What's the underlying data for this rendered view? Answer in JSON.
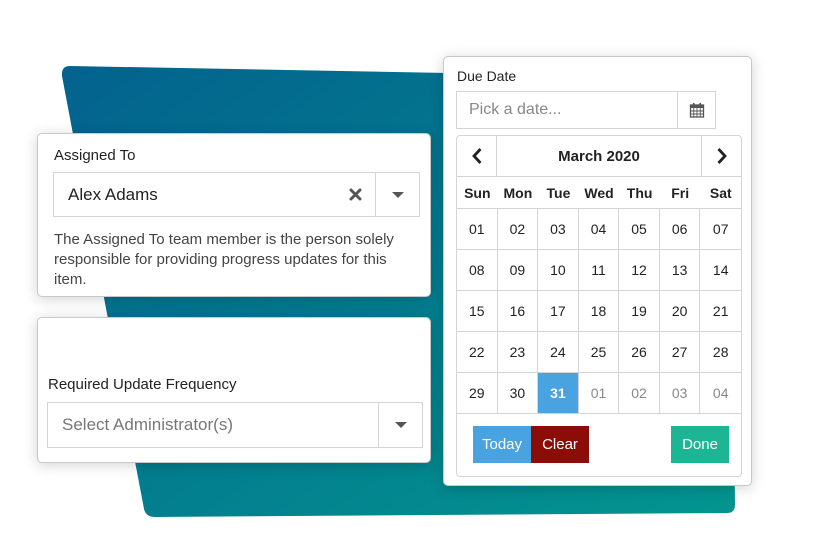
{
  "theme": {
    "accent_blue": "#49a3e0",
    "clear_red": "#8c0d07",
    "done_green": "#1cb694",
    "bg_gradient_start": "#03628e",
    "bg_gradient_end": "#03958f"
  },
  "assigned_to": {
    "label": "Assigned To",
    "value": "Alex Adams",
    "clear_icon": "close-icon",
    "dropdown_icon": "caret-down-icon",
    "help_text": "The Assigned To team member is the person solely responsible for providing progress updates for this item."
  },
  "update_frequency": {
    "label": "Required Update Frequency",
    "placeholder": "Select Administrator(s)",
    "dropdown_icon": "caret-down-icon"
  },
  "due_date": {
    "label": "Due Date",
    "placeholder": "Pick a date...",
    "value": "",
    "calendar_icon": "calendar-icon"
  },
  "calendar": {
    "month_title": "March 2020",
    "prev_icon": "chevron-left-icon",
    "next_icon": "chevron-right-icon",
    "weekdays": [
      "Sun",
      "Mon",
      "Tue",
      "Wed",
      "Thu",
      "Fri",
      "Sat"
    ],
    "days": [
      {
        "label": "01",
        "muted": false,
        "selected": false
      },
      {
        "label": "02",
        "muted": false,
        "selected": false
      },
      {
        "label": "03",
        "muted": false,
        "selected": false
      },
      {
        "label": "04",
        "muted": false,
        "selected": false
      },
      {
        "label": "05",
        "muted": false,
        "selected": false
      },
      {
        "label": "06",
        "muted": false,
        "selected": false
      },
      {
        "label": "07",
        "muted": false,
        "selected": false
      },
      {
        "label": "08",
        "muted": false,
        "selected": false
      },
      {
        "label": "09",
        "muted": false,
        "selected": false
      },
      {
        "label": "10",
        "muted": false,
        "selected": false
      },
      {
        "label": "11",
        "muted": false,
        "selected": false
      },
      {
        "label": "12",
        "muted": false,
        "selected": false
      },
      {
        "label": "13",
        "muted": false,
        "selected": false
      },
      {
        "label": "14",
        "muted": false,
        "selected": false
      },
      {
        "label": "15",
        "muted": false,
        "selected": false
      },
      {
        "label": "16",
        "muted": false,
        "selected": false
      },
      {
        "label": "17",
        "muted": false,
        "selected": false
      },
      {
        "label": "18",
        "muted": false,
        "selected": false
      },
      {
        "label": "19",
        "muted": false,
        "selected": false
      },
      {
        "label": "20",
        "muted": false,
        "selected": false
      },
      {
        "label": "21",
        "muted": false,
        "selected": false
      },
      {
        "label": "22",
        "muted": false,
        "selected": false
      },
      {
        "label": "23",
        "muted": false,
        "selected": false
      },
      {
        "label": "24",
        "muted": false,
        "selected": false
      },
      {
        "label": "25",
        "muted": false,
        "selected": false
      },
      {
        "label": "26",
        "muted": false,
        "selected": false
      },
      {
        "label": "27",
        "muted": false,
        "selected": false
      },
      {
        "label": "28",
        "muted": false,
        "selected": false
      },
      {
        "label": "29",
        "muted": false,
        "selected": false
      },
      {
        "label": "30",
        "muted": false,
        "selected": false
      },
      {
        "label": "31",
        "muted": false,
        "selected": true
      },
      {
        "label": "01",
        "muted": true,
        "selected": false
      },
      {
        "label": "02",
        "muted": true,
        "selected": false
      },
      {
        "label": "03",
        "muted": true,
        "selected": false
      },
      {
        "label": "04",
        "muted": true,
        "selected": false
      }
    ],
    "today_label": "Today",
    "clear_label": "Clear",
    "done_label": "Done"
  }
}
